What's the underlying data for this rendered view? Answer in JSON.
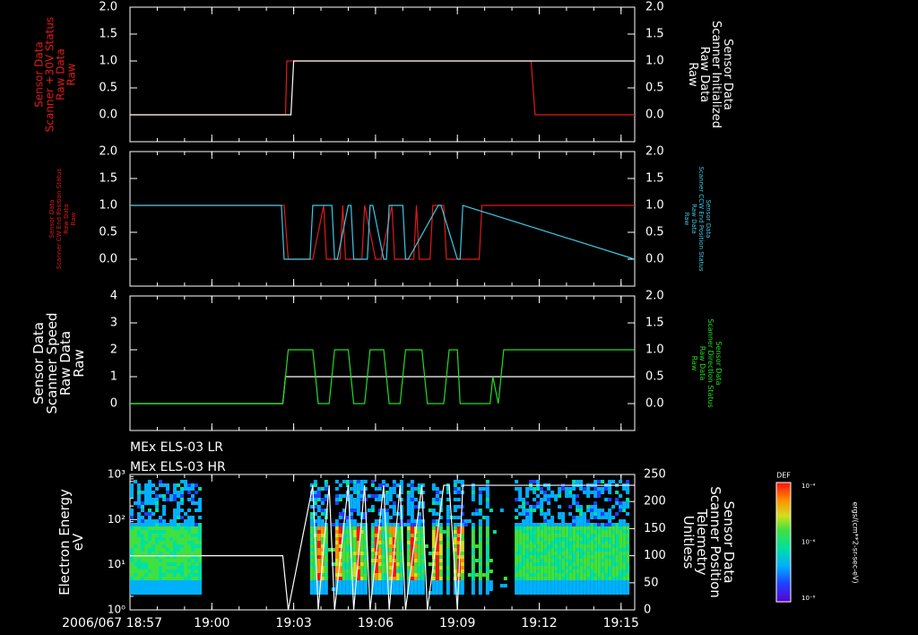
{
  "panels_text": {
    "p1_left": [
      "Sensor Data",
      "Scanner +30V Status",
      "Raw Data",
      "Raw"
    ],
    "p1_right": [
      "Sensor Data",
      "Scanner Initialized",
      "Raw Data",
      "Raw"
    ],
    "p2_left": [
      "Sensor Data",
      "Scanner CW End Position Status",
      "Raw Data",
      "Raw"
    ],
    "p2_right": [
      "Sensor Data",
      "Scanner CCW End Position Status",
      "Raw Data",
      "Raw"
    ],
    "p3_left": [
      "Sensor Data",
      "Scanner Speed",
      "Raw Data",
      "Raw"
    ],
    "p3_right": [
      "Sensor Data",
      "Scanner Direction Status",
      "Raw Data",
      "Raw"
    ],
    "p4_left": [
      "Electron Energy",
      "eV"
    ],
    "p4_right": [
      "Sensor Data",
      "Scanner Position",
      "Telemetry",
      "Unitless"
    ],
    "instrument_lines": [
      "MEx ELS-03 LR",
      "MEx ELS-03 HR"
    ],
    "colorbar_title": "DEF",
    "colorbar_units": "ergs/(cm**2-sr-sec-eV)",
    "colorbar_ticks": [
      "10⁻⁴",
      "10⁻⁶",
      "10⁻⁸"
    ]
  },
  "colors": {
    "red": "#e01a1a",
    "white": "#ffffff",
    "cyan": "#3cc8e6",
    "green": "#22dd22"
  },
  "chart_data": [
    {
      "type": "line",
      "panel": "scanner-30v-initialized",
      "x_unit": "minutes after 18:57",
      "ylim": [
        -0.5,
        2.0
      ],
      "yticks_left": [
        "0.0",
        "0.5",
        "1.0",
        "1.5",
        "2.0"
      ],
      "yticks_right": [
        "0.0",
        "0.5",
        "1.0",
        "1.5",
        "2.0"
      ],
      "series": [
        {
          "name": "Scanner +30V Status",
          "color": "red",
          "x": [
            0,
            5.7,
            5.75,
            5.95,
            6.0,
            14.7,
            14.85,
            18.5
          ],
          "y": [
            0,
            0,
            1,
            1,
            1,
            1,
            0,
            0
          ]
        },
        {
          "name": "Scanner Initialized",
          "color": "white",
          "x": [
            0,
            5.9,
            6.0,
            14.65,
            14.7,
            18.5
          ],
          "y": [
            0,
            0,
            1,
            1,
            1,
            1
          ]
        }
      ]
    },
    {
      "type": "line",
      "panel": "scanner-end-positions",
      "ylim": [
        -0.5,
        2.0
      ],
      "yticks_left": [
        "0.0",
        "0.5",
        "1.0",
        "1.5",
        "2.0"
      ],
      "yticks_right": [
        "0.0",
        "0.5",
        "1.0",
        "1.5",
        "2.0"
      ],
      "series": [
        {
          "name": "Scanner CW End Position Status",
          "color": "red",
          "x": [
            0,
            5.65,
            5.8,
            6.6,
            6.7,
            7.1,
            7.2,
            7.3,
            7.7,
            7.8,
            7.9,
            8.4,
            8.5,
            8.6,
            9.0,
            9.1,
            9.2,
            9.6,
            9.7,
            9.8,
            10.4,
            10.5,
            10.6,
            11.0,
            11.1,
            11.5,
            11.6,
            12.1,
            12.15,
            12.8,
            12.9,
            18.5
          ],
          "y": [
            1,
            1,
            0,
            0,
            0,
            1,
            0,
            0,
            0,
            1,
            0,
            0,
            0,
            1,
            0,
            0,
            0,
            1,
            0,
            0,
            0,
            1,
            0,
            0,
            1,
            1,
            0,
            0,
            0,
            0,
            1,
            1
          ]
        },
        {
          "name": "Scanner CCW End Position Status",
          "color": "cyan",
          "x": [
            0,
            5.55,
            5.65,
            6.6,
            6.7,
            7.4,
            7.5,
            7.6,
            8.0,
            8.1,
            8.2,
            8.7,
            8.8,
            8.9,
            9.3,
            9.4,
            9.5,
            10.0,
            10.1,
            10.2,
            11.3,
            11.4,
            12.0,
            12.1,
            12.2,
            18.5
          ],
          "y": [
            1,
            1,
            0,
            0,
            1,
            1,
            0,
            0,
            1,
            1,
            0,
            0,
            1,
            1,
            0,
            0,
            1,
            1,
            0,
            0,
            1,
            1,
            0,
            0,
            1,
            0
          ]
        }
      ]
    },
    {
      "type": "line",
      "panel": "scanner-speed-direction",
      "ylim_left": [
        -1,
        4
      ],
      "yticks_left": [
        "0",
        "1",
        "2",
        "3",
        "4"
      ],
      "ylim_right": [
        -0.5,
        2.0
      ],
      "yticks_right": [
        "0.0",
        "0.5",
        "1.0",
        "1.5",
        "2.0"
      ],
      "series": [
        {
          "name": "Scanner Speed",
          "color": "white",
          "axis": "left",
          "x": [
            0,
            5.6,
            5.7,
            18.5
          ],
          "y": [
            0,
            0,
            1,
            1
          ]
        },
        {
          "name": "Scanner Direction Status",
          "color": "green",
          "axis": "right",
          "x": [
            0,
            5.6,
            5.8,
            6.7,
            6.9,
            7.3,
            7.5,
            8.0,
            8.2,
            8.6,
            8.8,
            9.3,
            9.5,
            9.9,
            10.1,
            10.7,
            10.9,
            11.5,
            11.7,
            12.0,
            12.1,
            13.2,
            13.3,
            13.5,
            13.7,
            18.5
          ],
          "y": [
            0,
            0,
            1,
            1,
            0,
            0,
            1,
            1,
            0,
            0,
            1,
            1,
            0,
            0,
            1,
            1,
            0,
            0,
            1,
            1,
            0,
            0,
            0.5,
            0,
            1,
            1
          ]
        }
      ]
    },
    {
      "type": "heatmap",
      "panel": "electron-spectrogram",
      "x_ticks": [
        "2006/067 18:57",
        "19:00",
        "19:03",
        "19:06",
        "19:09",
        "19:12",
        "19:15"
      ],
      "x_tick_minutes": [
        0,
        3,
        6,
        9,
        12,
        15,
        18
      ],
      "xlim_minutes": [
        0,
        18.5
      ],
      "y_log_range": [
        1,
        1000
      ],
      "yticks_left": [
        "10⁰",
        "10¹",
        "10²",
        "10³"
      ],
      "ylim_right": [
        0,
        250
      ],
      "yticks_right": [
        "0",
        "50",
        "100",
        "150",
        "200",
        "250"
      ],
      "data_blocks_minutes": [
        [
          0,
          2.6
        ],
        [
          6.6,
          13.7
        ],
        [
          14.1,
          18.3
        ]
      ],
      "intense_bursts_minutes": [
        6.9,
        7.6,
        8.3,
        9.0,
        9.6,
        10.3,
        11.2,
        12.0
      ],
      "position_series": {
        "name": "Scanner Position",
        "color": "white",
        "x": [
          0,
          5.6,
          5.8,
          6.7,
          6.9,
          7.3,
          7.5,
          8.0,
          8.2,
          8.6,
          8.8,
          9.3,
          9.5,
          9.9,
          10.1,
          10.7,
          10.9,
          11.5,
          11.7,
          12.0,
          12.2,
          13.0,
          13.3,
          18.5
        ],
        "y": [
          100,
          100,
          0,
          230,
          0,
          230,
          0,
          230,
          0,
          230,
          0,
          230,
          0,
          230,
          0,
          230,
          0,
          230,
          230,
          0,
          230,
          230,
          230,
          230
        ]
      }
    }
  ]
}
